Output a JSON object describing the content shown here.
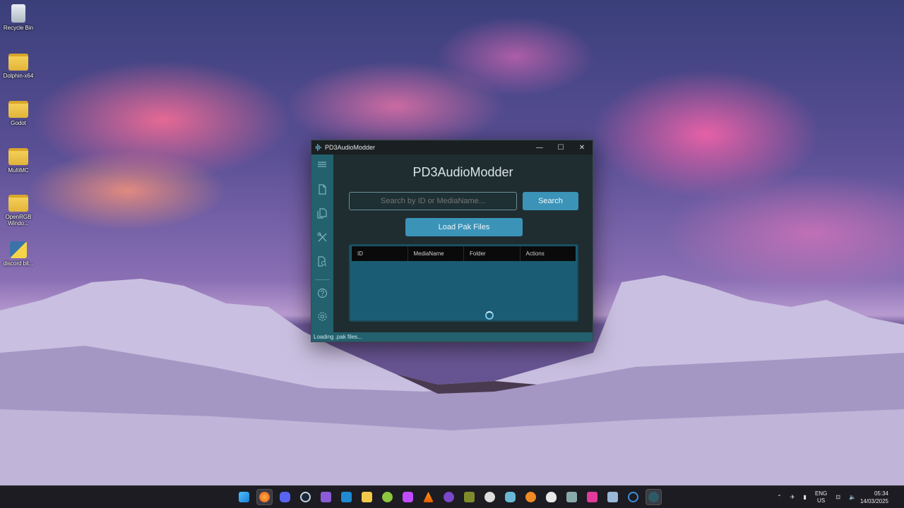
{
  "desktop": {
    "icons": [
      {
        "label": "Recycle Bin",
        "icon": "recycle-bin-icon"
      },
      {
        "label": "Dolphin-x64",
        "icon": "folder-icon"
      },
      {
        "label": "Godot",
        "icon": "folder-icon"
      },
      {
        "label": "MultiMC",
        "icon": "folder-icon"
      },
      {
        "label": "OpenRGB Windo...",
        "icon": "folder-icon"
      },
      {
        "label": "discord bll...",
        "icon": "python-file-icon"
      }
    ]
  },
  "window": {
    "title": "PD3AudioModder",
    "controls": {
      "minimize": "—",
      "maximize": "☐",
      "close": "✕"
    }
  },
  "app": {
    "heading": "PD3AudioModder",
    "search_placeholder": "Search by ID or MediaName...",
    "search_label": "Search",
    "load_label": "Load Pak Files",
    "table": {
      "columns": [
        "ID",
        "MediaName",
        "Folder",
        "Actions"
      ],
      "rows": []
    },
    "status": "Loading .pak files...",
    "sidebar": [
      "menu-icon",
      "file-icon",
      "files-icon",
      "tools-icon",
      "search-file-icon",
      "help-icon",
      "settings-icon"
    ]
  },
  "taskbar": {
    "language": "ENG",
    "region": "US",
    "time": "05:34",
    "date": "14/03/2025"
  }
}
